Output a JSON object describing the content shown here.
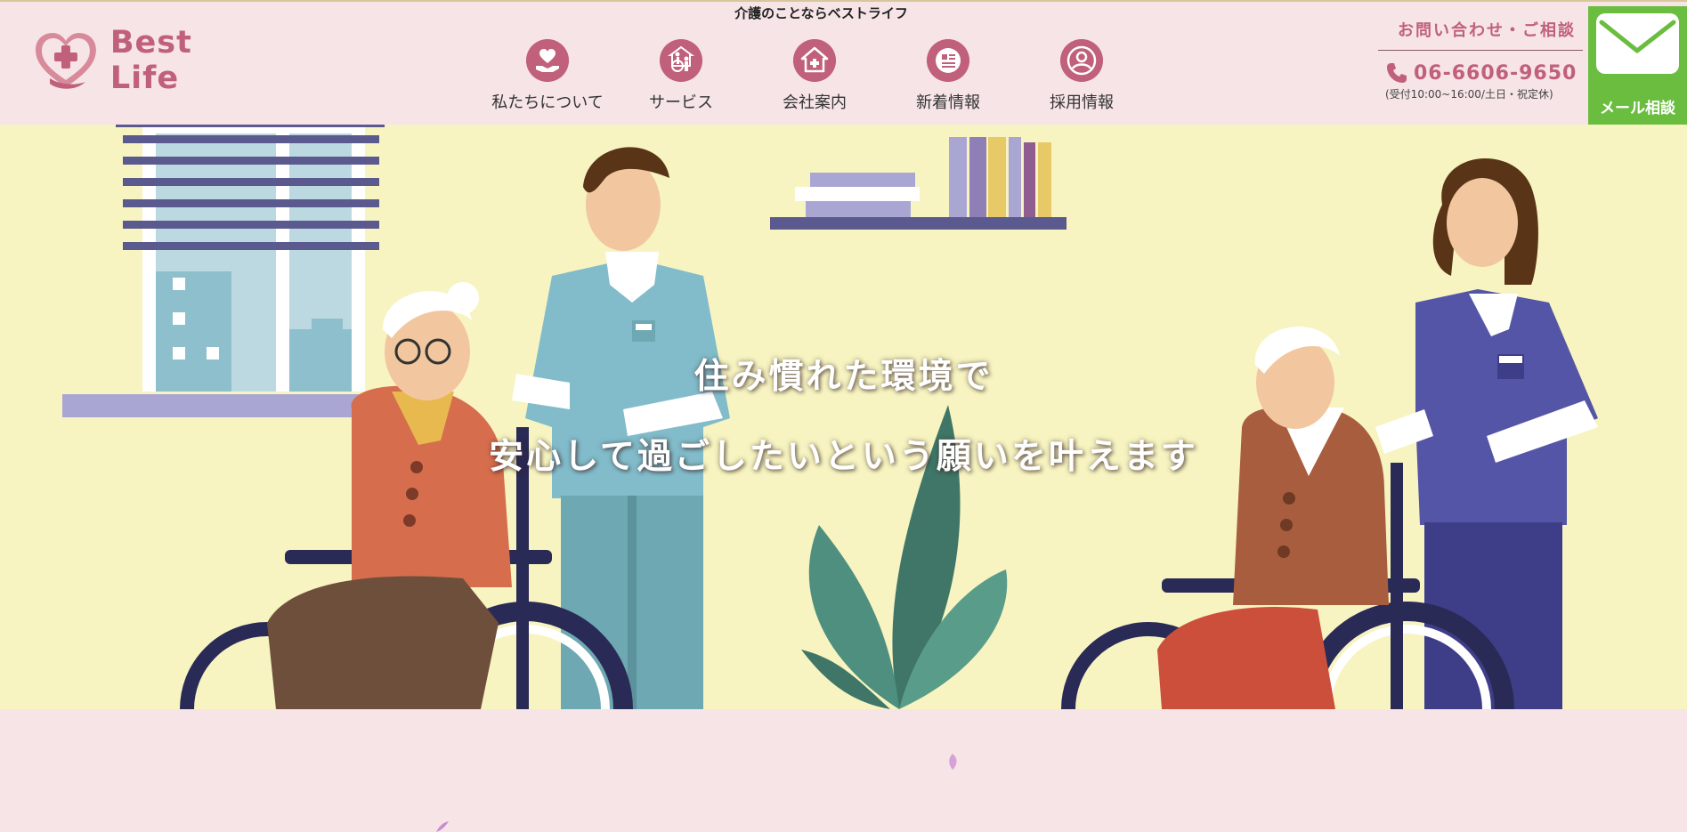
{
  "header": {
    "tagline": "介護のことならベストライフ",
    "logo_text": "Best Life",
    "nav": [
      {
        "label": "私たちについて",
        "icon": "heart-hand-icon"
      },
      {
        "label": "サービス",
        "icon": "wheelchair-icon"
      },
      {
        "label": "会社案内",
        "icon": "house-icon"
      },
      {
        "label": "新着情報",
        "icon": "news-icon"
      },
      {
        "label": "採用情報",
        "icon": "person-icon"
      }
    ],
    "contact": {
      "title": "お問い合わせ・ご相談",
      "phone": "06-6606-9650",
      "hours": "(受付10:00~16:00/土日・祝定休)"
    },
    "mail_button": "メール相談"
  },
  "hero": {
    "line1": "住み慣れた環境で",
    "line2": "安心して過ごしたいという願いを叶えます"
  },
  "colors": {
    "brand_pink": "#c0607a",
    "header_bg": "#f6e4e6",
    "hero_bg": "#f7f4c1",
    "mail_green": "#6bbd3f"
  }
}
